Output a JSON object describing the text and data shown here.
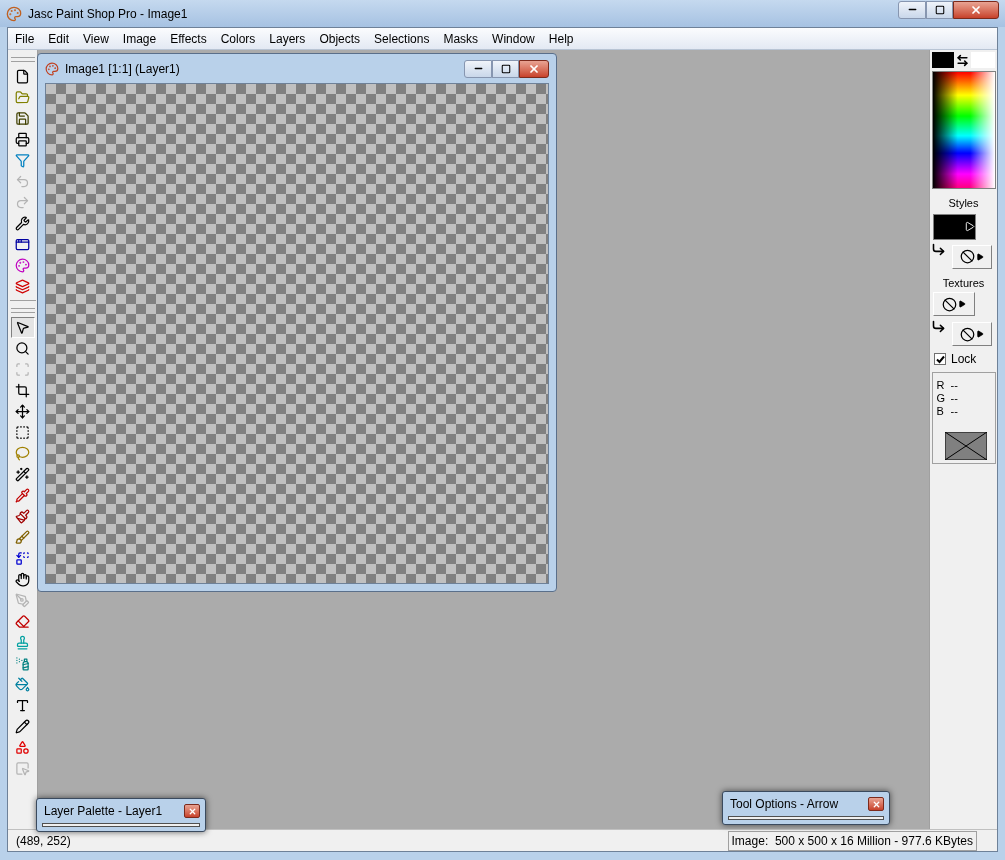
{
  "window": {
    "title": "Jasc Paint Shop Pro - Image1"
  },
  "menu": [
    "File",
    "Edit",
    "View",
    "Image",
    "Effects",
    "Colors",
    "Layers",
    "Objects",
    "Selections",
    "Masks",
    "Window",
    "Help"
  ],
  "toolbar": {
    "standard": [
      {
        "kind": "new",
        "disabled": false
      },
      {
        "kind": "open",
        "disabled": false
      },
      {
        "kind": "save",
        "disabled": false
      },
      {
        "kind": "print",
        "disabled": false
      },
      {
        "kind": "browse",
        "disabled": false
      },
      {
        "kind": "undo",
        "disabled": true
      },
      {
        "kind": "redo",
        "disabled": true
      },
      {
        "kind": "fullscreen",
        "disabled": false
      },
      {
        "kind": "toolbars",
        "disabled": false
      },
      {
        "kind": "palette",
        "disabled": false
      },
      {
        "kind": "layers",
        "disabled": false
      }
    ],
    "tools": [
      {
        "kind": "arrow",
        "selected": true,
        "disabled": false
      },
      {
        "kind": "zoom",
        "selected": false,
        "disabled": false
      },
      {
        "kind": "deform",
        "selected": false,
        "disabled": true
      },
      {
        "kind": "crop",
        "selected": false,
        "disabled": false
      },
      {
        "kind": "move",
        "selected": false,
        "disabled": false
      },
      {
        "kind": "selection",
        "selected": false,
        "disabled": false
      },
      {
        "kind": "lasso",
        "selected": false,
        "disabled": false
      },
      {
        "kind": "wand",
        "selected": false,
        "disabled": false
      },
      {
        "kind": "dropper",
        "selected": false,
        "disabled": false
      },
      {
        "kind": "brush",
        "selected": false,
        "disabled": false
      },
      {
        "kind": "clone",
        "selected": false,
        "disabled": false
      },
      {
        "kind": "replace",
        "selected": false,
        "disabled": false
      },
      {
        "kind": "retouch",
        "selected": false,
        "disabled": false
      },
      {
        "kind": "scratch",
        "selected": false,
        "disabled": true
      },
      {
        "kind": "eraser",
        "selected": false,
        "disabled": false
      },
      {
        "kind": "tube",
        "selected": false,
        "disabled": false
      },
      {
        "kind": "airbrush",
        "selected": false,
        "disabled": false
      },
      {
        "kind": "fill",
        "selected": false,
        "disabled": false
      },
      {
        "kind": "text",
        "selected": false,
        "disabled": false
      },
      {
        "kind": "draw",
        "selected": false,
        "disabled": false
      },
      {
        "kind": "shapes",
        "selected": false,
        "disabled": false
      },
      {
        "kind": "objects",
        "selected": false,
        "disabled": true
      }
    ]
  },
  "image_window": {
    "title": "Image1 [1:1] (Layer1)"
  },
  "color_palette": {
    "swatches": [
      {
        "color": "#000000"
      },
      {
        "color": "#ffffff"
      }
    ],
    "styles_label": "Styles",
    "textures_label": "Textures",
    "lock": {
      "label": "Lock",
      "checked": true
    },
    "readout": [
      {
        "label": "R",
        "value": "--"
      },
      {
        "label": "G",
        "value": "--"
      },
      {
        "label": "B",
        "value": "--"
      }
    ]
  },
  "floating_palettes": [
    {
      "title": "Layer Palette - Layer1"
    },
    {
      "title": "Tool Options - Arrow"
    }
  ],
  "status_bar": {
    "position": "(489, 252)",
    "image_info": "Image:  500 x 500 x 16 Million - 977.6 KBytes"
  }
}
